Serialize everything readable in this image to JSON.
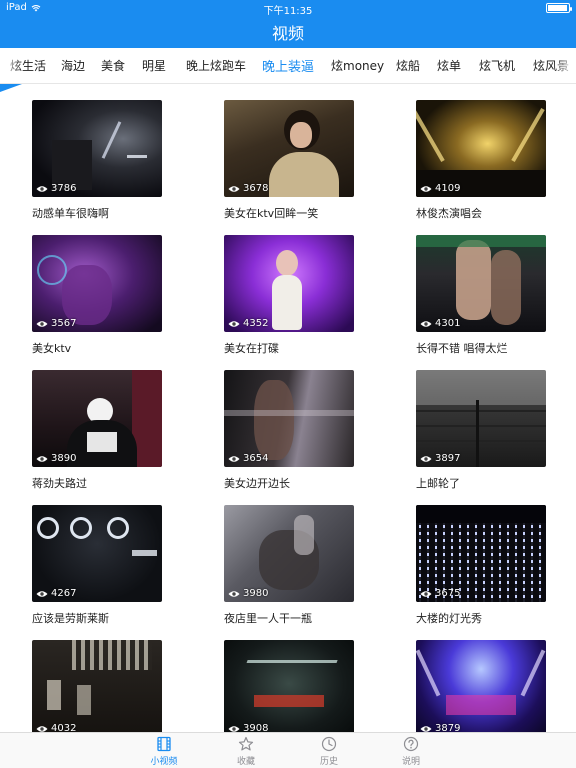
{
  "status_bar": {
    "device": "iPad",
    "time": "下午11:35"
  },
  "nav": {
    "title": "视频"
  },
  "categories": [
    "炫生活",
    "海边",
    "美食",
    "明星",
    "晚上炫跑车",
    "晚上装逼",
    "炫money",
    "炫船",
    "炫单",
    "炫飞机",
    "炫风景"
  ],
  "active_category": "晚上装逼",
  "videos": [
    {
      "title": "动感单车很嗨啊",
      "views": "3786"
    },
    {
      "title": "美女在ktv回眸一笑",
      "views": "3678"
    },
    {
      "title": "林俊杰演唱会",
      "views": "4109"
    },
    {
      "title": "美女ktv",
      "views": "3567"
    },
    {
      "title": "美女在打碟",
      "views": "4352"
    },
    {
      "title": "长得不错 唱得太烂",
      "views": "4301"
    },
    {
      "title": "蒋劲夫路过",
      "views": "3890"
    },
    {
      "title": "美女边开边长",
      "views": "3654"
    },
    {
      "title": "上邮轮了",
      "views": "3897"
    },
    {
      "title": "应该是劳斯莱斯",
      "views": "4267"
    },
    {
      "title": "夜店里一人干一瓶",
      "views": "3980"
    },
    {
      "title": "大楼的灯光秀",
      "views": "3675"
    },
    {
      "title": "",
      "views": "4032"
    },
    {
      "title": "",
      "views": "3908"
    },
    {
      "title": "",
      "views": "3879"
    }
  ],
  "tabs": [
    {
      "label": "小视频",
      "icon": "film-icon",
      "active": true
    },
    {
      "label": "收藏",
      "icon": "star-icon",
      "active": false
    },
    {
      "label": "历史",
      "icon": "clock-icon",
      "active": false
    },
    {
      "label": "说明",
      "icon": "question-icon",
      "active": false
    }
  ],
  "colors": {
    "accent": "#1a8cf0",
    "tab_inactive": "#8e8e93"
  }
}
